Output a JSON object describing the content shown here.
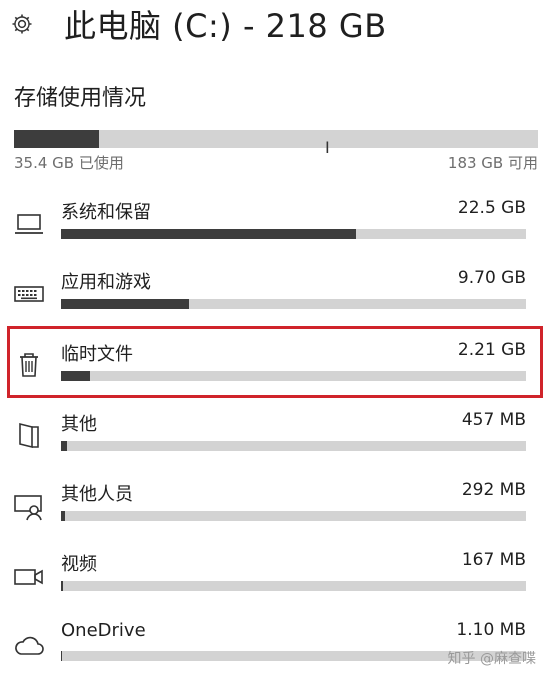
{
  "header": {
    "title": "此电脑 (C:) - 218 GB"
  },
  "storage": {
    "section_title": "存储使用情况",
    "used_label": "35.4 GB 已使用",
    "free_label": "183 GB 可用",
    "used_fraction": 0.162
  },
  "items": [
    {
      "label": "系统和保留",
      "size": "22.5 GB",
      "fraction": 0.635,
      "icon": "laptop-icon"
    },
    {
      "label": "应用和游戏",
      "size": "9.70 GB",
      "fraction": 0.275,
      "icon": "keyboard-icon"
    },
    {
      "label": "临时文件",
      "size": "2.21 GB",
      "fraction": 0.063,
      "icon": "trash-icon"
    },
    {
      "label": "其他",
      "size": "457 MB",
      "fraction": 0.013,
      "icon": "document-icon"
    },
    {
      "label": "其他人员",
      "size": "292 MB",
      "fraction": 0.008,
      "icon": "user-icon"
    },
    {
      "label": "视频",
      "size": "167 MB",
      "fraction": 0.005,
      "icon": "video-icon"
    },
    {
      "label": "OneDrive",
      "size": "1.10 MB",
      "fraction": 0.002,
      "icon": "cloud-icon"
    }
  ],
  "watermark": "知乎 @麻查喋",
  "colors": {
    "bar_fill": "#3d3d3d",
    "bar_track": "#d3d3d3",
    "highlight": "#d0232a"
  }
}
